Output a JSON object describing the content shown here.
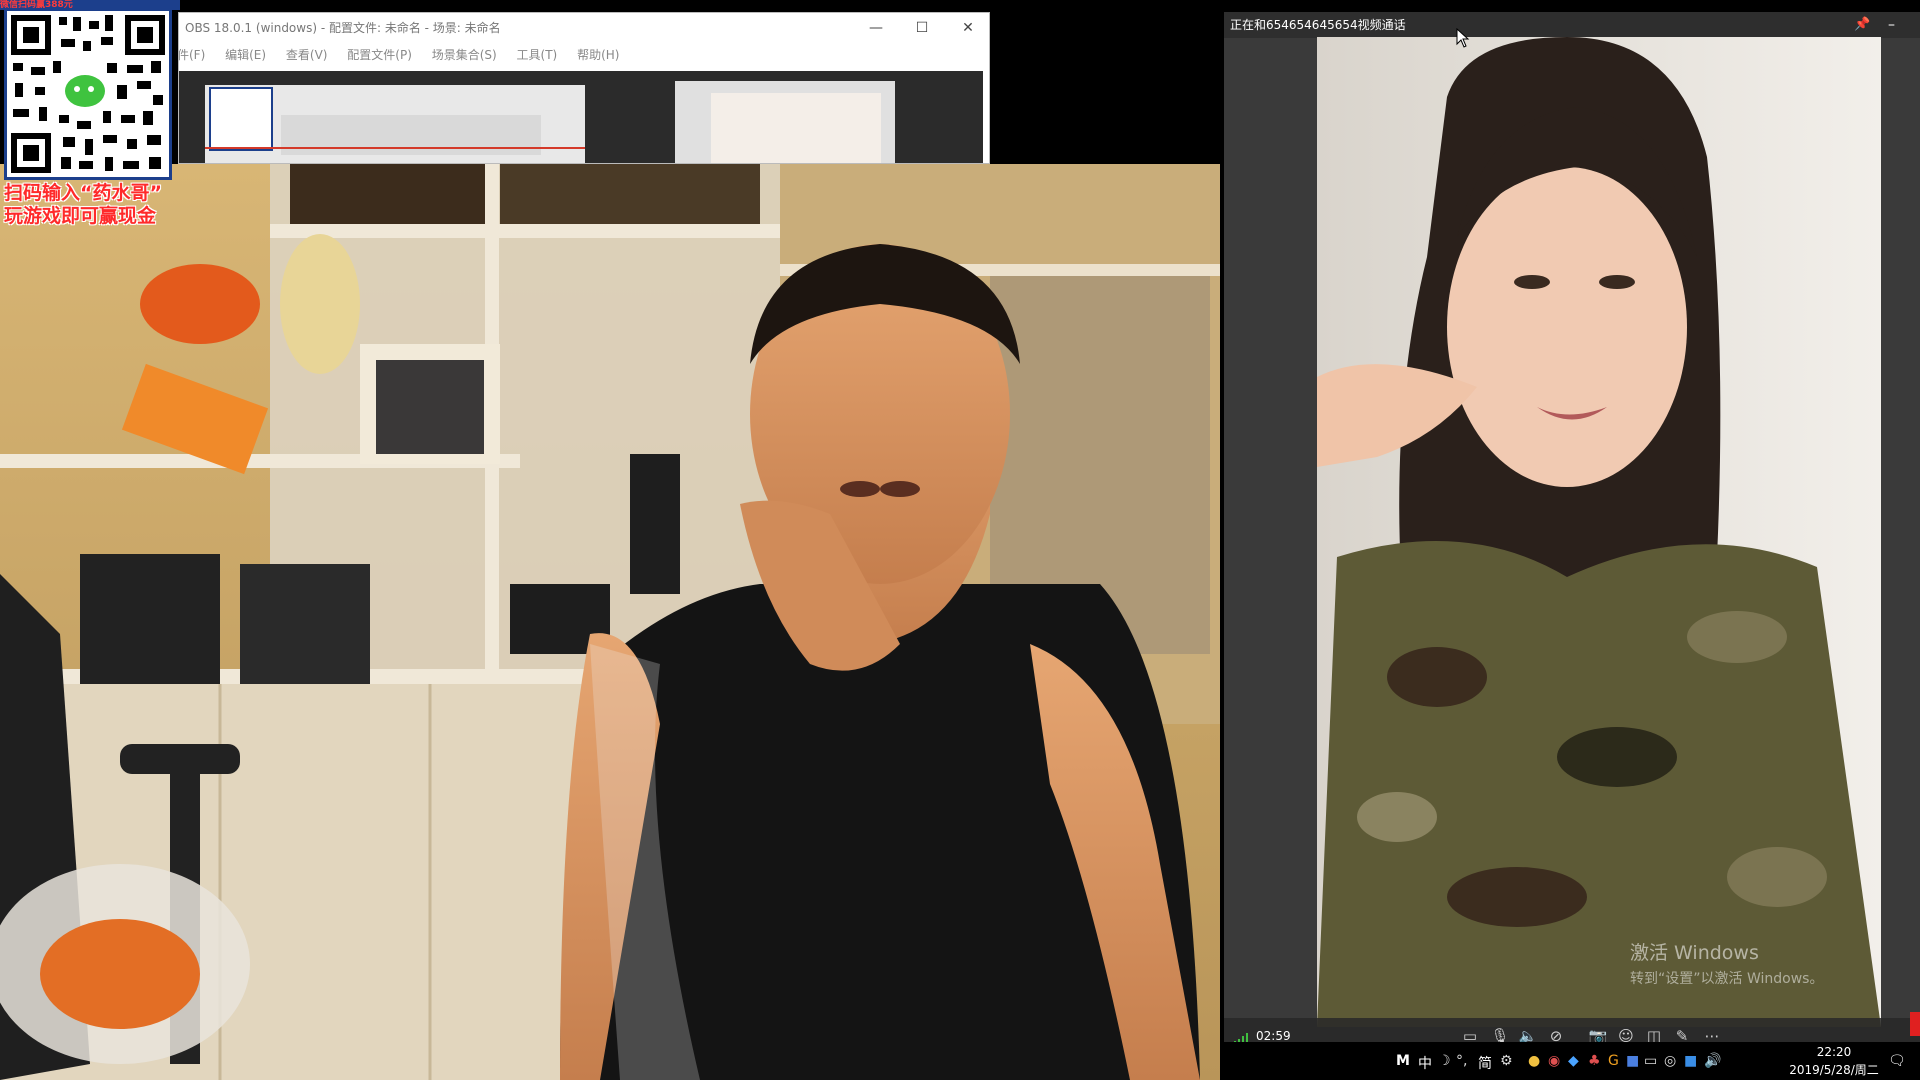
{
  "qr_overlay": {
    "banner_text": "微信扫码赢388元",
    "caption_line1": "扫码输入“药水哥”",
    "caption_line2": "玩游戏即可赢现金"
  },
  "obs_window": {
    "title": "OBS 18.0.1 (windows) - 配置文件: 未命名 - 场景: 未命名",
    "menu": [
      "文件(F)",
      "编辑(E)",
      "查看(V)",
      "配置文件(P)",
      "场景集合(S)",
      "工具(T)",
      "帮助(H)"
    ],
    "buttons": {
      "minimize": "—",
      "maximize": "☐",
      "close": "✕"
    }
  },
  "call_window": {
    "title": "正在和654654645654视频通话",
    "timer": "02:59",
    "pin_icon": "pin-icon",
    "minimize": "–"
  },
  "watermark": {
    "line1": "激活 Windows",
    "line2": "转到“设置”以激活 Windows。"
  },
  "taskbar": {
    "ime_m": "M",
    "ime_zh": "中",
    "ime_jian": "简",
    "time": "22:20",
    "date": "2019/5/28/周二"
  },
  "colors": {
    "caption_red": "#ff2a2a",
    "qr_border": "#1c3f8c",
    "timer_green": "#3fbf3f"
  }
}
